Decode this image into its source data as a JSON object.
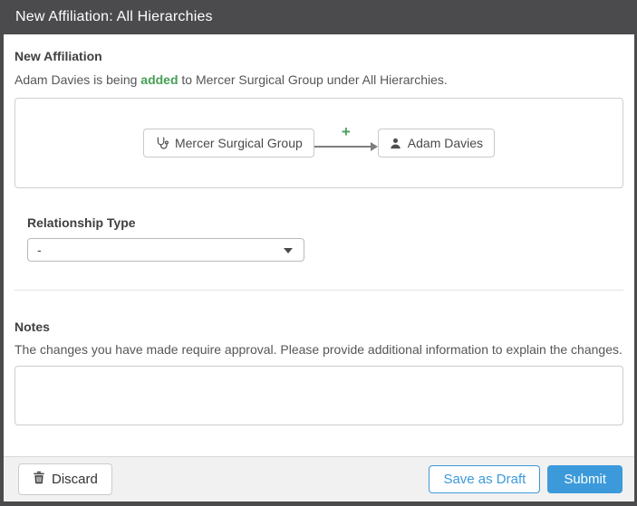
{
  "modal": {
    "title": "New Affiliation: All Hierarchies"
  },
  "affiliation": {
    "heading": "New Affiliation",
    "sentence_prefix": "Adam Davies is being",
    "sentence_highlight": "added",
    "sentence_suffix": "to Mercer Surgical Group under All Hierarchies.",
    "diagram": {
      "from_node": "Mercer Surgical Group",
      "plus_symbol": "+",
      "to_node": "Adam Davies"
    }
  },
  "relationship": {
    "label": "Relationship Type",
    "selected_value": "-"
  },
  "notes": {
    "heading": "Notes",
    "description": "The changes you have made require approval. Please provide additional information to explain the changes.",
    "value": ""
  },
  "footer": {
    "discard_label": "Discard",
    "save_draft_label": "Save as Draft",
    "submit_label": "Submit"
  },
  "colors": {
    "header_bg": "#4b4b4d",
    "accent_blue": "#3c9adb",
    "success_green": "#46a055",
    "footer_bg": "#f1f1f1"
  },
  "icons": {
    "organization": "stethoscope-icon",
    "person": "user-icon",
    "add": "plus-icon",
    "connector": "arrow-right-icon",
    "discard": "trash-icon",
    "dropdown": "caret-down-icon"
  }
}
